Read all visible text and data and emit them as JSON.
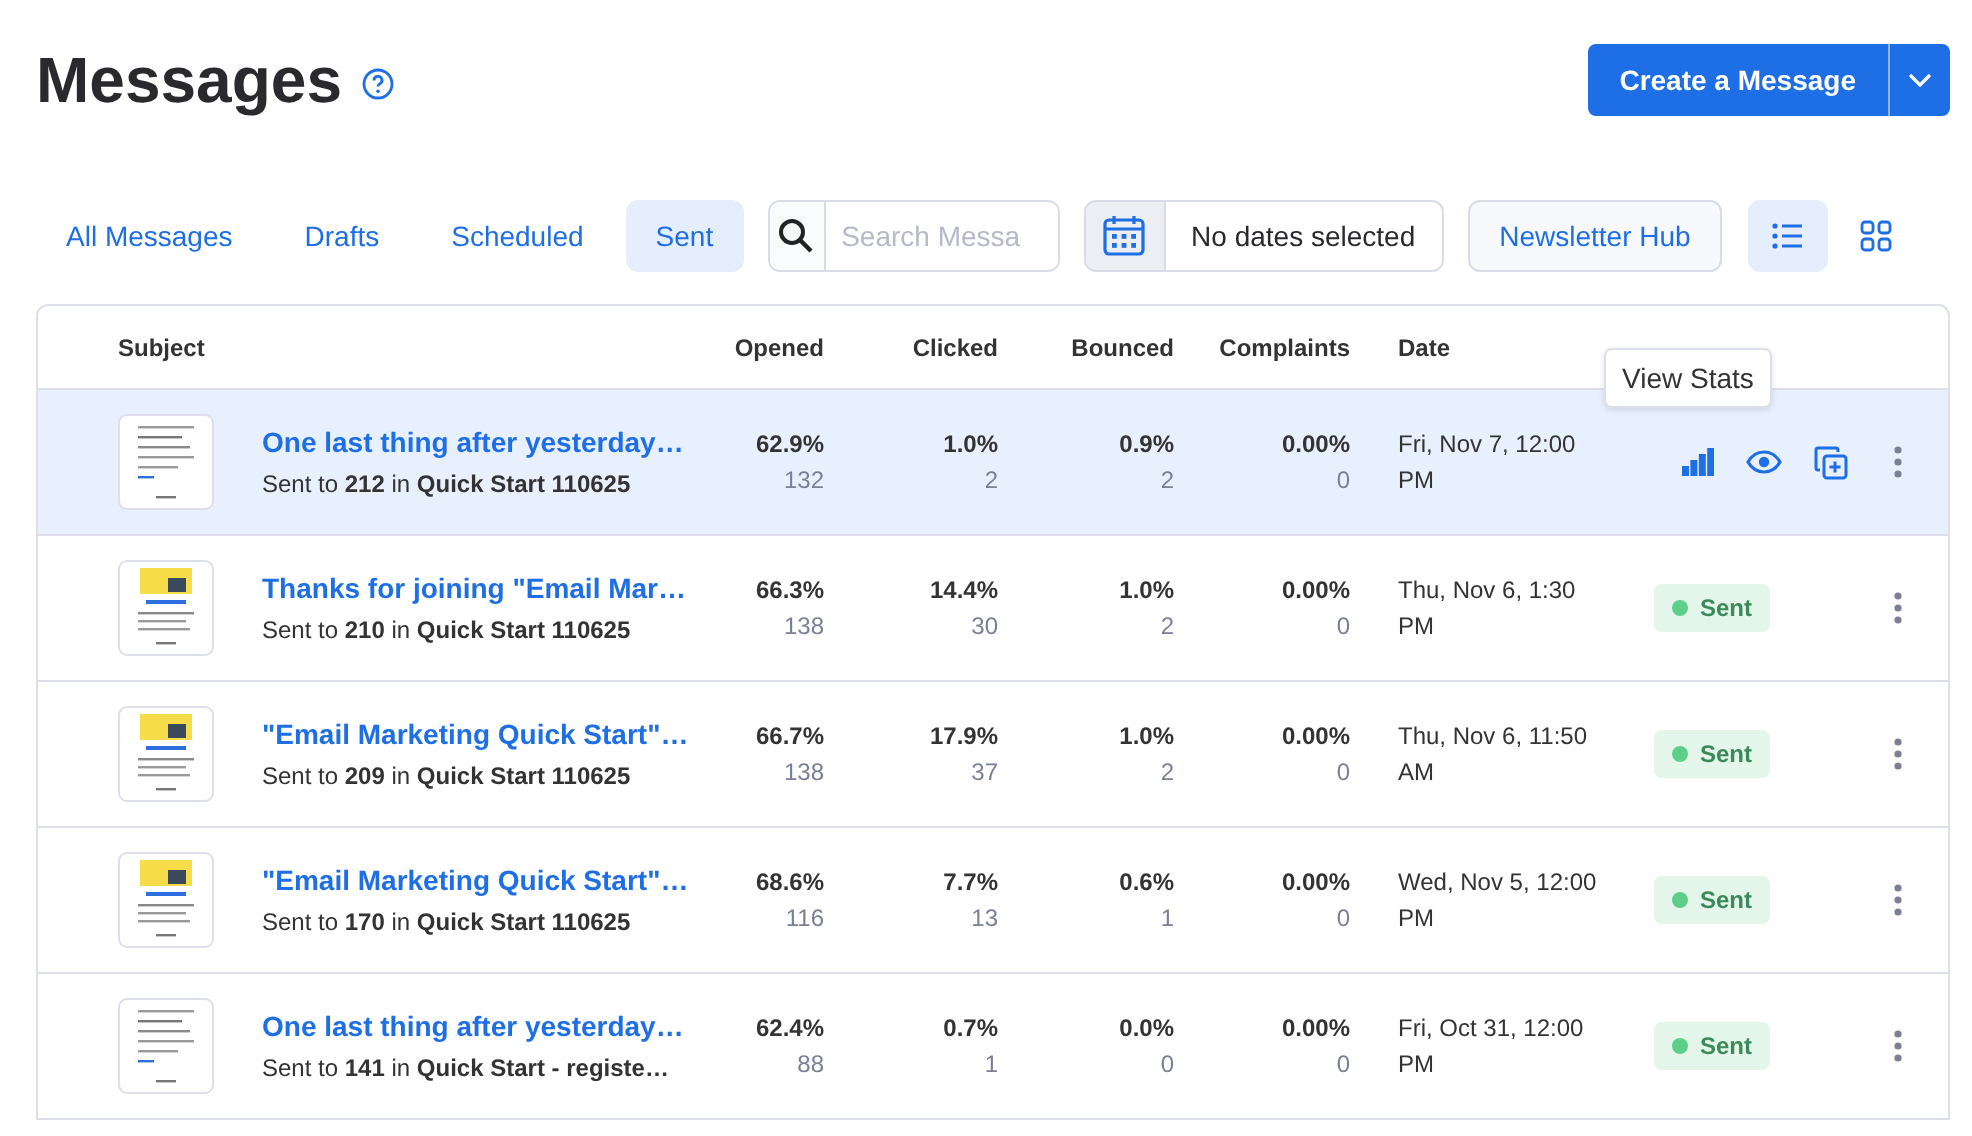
{
  "page": {
    "title": "Messages",
    "create_button": "Create a Message"
  },
  "tabs": [
    {
      "label": "All Messages",
      "selected": false
    },
    {
      "label": "Drafts",
      "selected": false
    },
    {
      "label": "Scheduled",
      "selected": false
    },
    {
      "label": "Sent",
      "selected": true
    }
  ],
  "search": {
    "placeholder": "Search Messa"
  },
  "date_filter": {
    "value": "No dates selected"
  },
  "newsletter_button": "Newsletter Hub",
  "view_toggle": [
    {
      "kind": "list",
      "selected": true
    },
    {
      "kind": "grid",
      "selected": false
    }
  ],
  "table": {
    "columns": [
      "Subject",
      "Opened",
      "Clicked",
      "Bounced",
      "Complaints",
      "Date"
    ],
    "tooltip": "View Stats",
    "rows": [
      {
        "subject": "One last thing after yesterday…",
        "recipients": "Sent to **212** in **Quick Start 110625**",
        "banner": false,
        "opened": "62.9%",
        "opened_count": "132",
        "clicked": "1.0%",
        "clicked_count": "2",
        "bounced": "0.9%",
        "bounced_count": "2",
        "complaints": "0.00%",
        "complaints_count": "0",
        "date": "Fri, Nov 7, 12:00 PM",
        "hovered": true
      },
      {
        "subject": "Thanks for joining \"Email Mar…",
        "recipients": "Sent to **210** in **Quick Start 110625**",
        "banner": true,
        "opened": "66.3%",
        "opened_count": "138",
        "clicked": "14.4%",
        "clicked_count": "30",
        "bounced": "1.0%",
        "bounced_count": "2",
        "complaints": "0.00%",
        "complaints_count": "0",
        "date": "Thu, Nov 6, 1:30 PM",
        "status": "Sent",
        "hovered": false
      },
      {
        "subject": "\"Email Marketing Quick Start\"…",
        "recipients": "Sent to **209** in **Quick Start 110625**",
        "banner": true,
        "opened": "66.7%",
        "opened_count": "138",
        "clicked": "17.9%",
        "clicked_count": "37",
        "bounced": "1.0%",
        "bounced_count": "2",
        "complaints": "0.00%",
        "complaints_count": "0",
        "date": "Thu, Nov 6, 11:50 AM",
        "status": "Sent",
        "hovered": false
      },
      {
        "subject": "\"Email Marketing Quick Start\"…",
        "recipients": "Sent to **170** in **Quick Start 110625**",
        "banner": true,
        "opened": "68.6%",
        "opened_count": "116",
        "clicked": "7.7%",
        "clicked_count": "13",
        "bounced": "0.6%",
        "bounced_count": "1",
        "complaints": "0.00%",
        "complaints_count": "0",
        "date": "Wed, Nov 5, 12:00 PM",
        "status": "Sent",
        "hovered": false
      },
      {
        "subject": "One last thing after yesterday…",
        "recipients": "Sent to **141** in **Quick Start - registe…**",
        "banner": false,
        "opened": "62.4%",
        "opened_count": "88",
        "clicked": "0.7%",
        "clicked_count": "1",
        "bounced": "0.0%",
        "bounced_count": "0",
        "complaints": "0.00%",
        "complaints_count": "0",
        "date": "Fri, Oct 31, 12:00 PM",
        "status": "Sent",
        "hovered": false
      }
    ]
  }
}
